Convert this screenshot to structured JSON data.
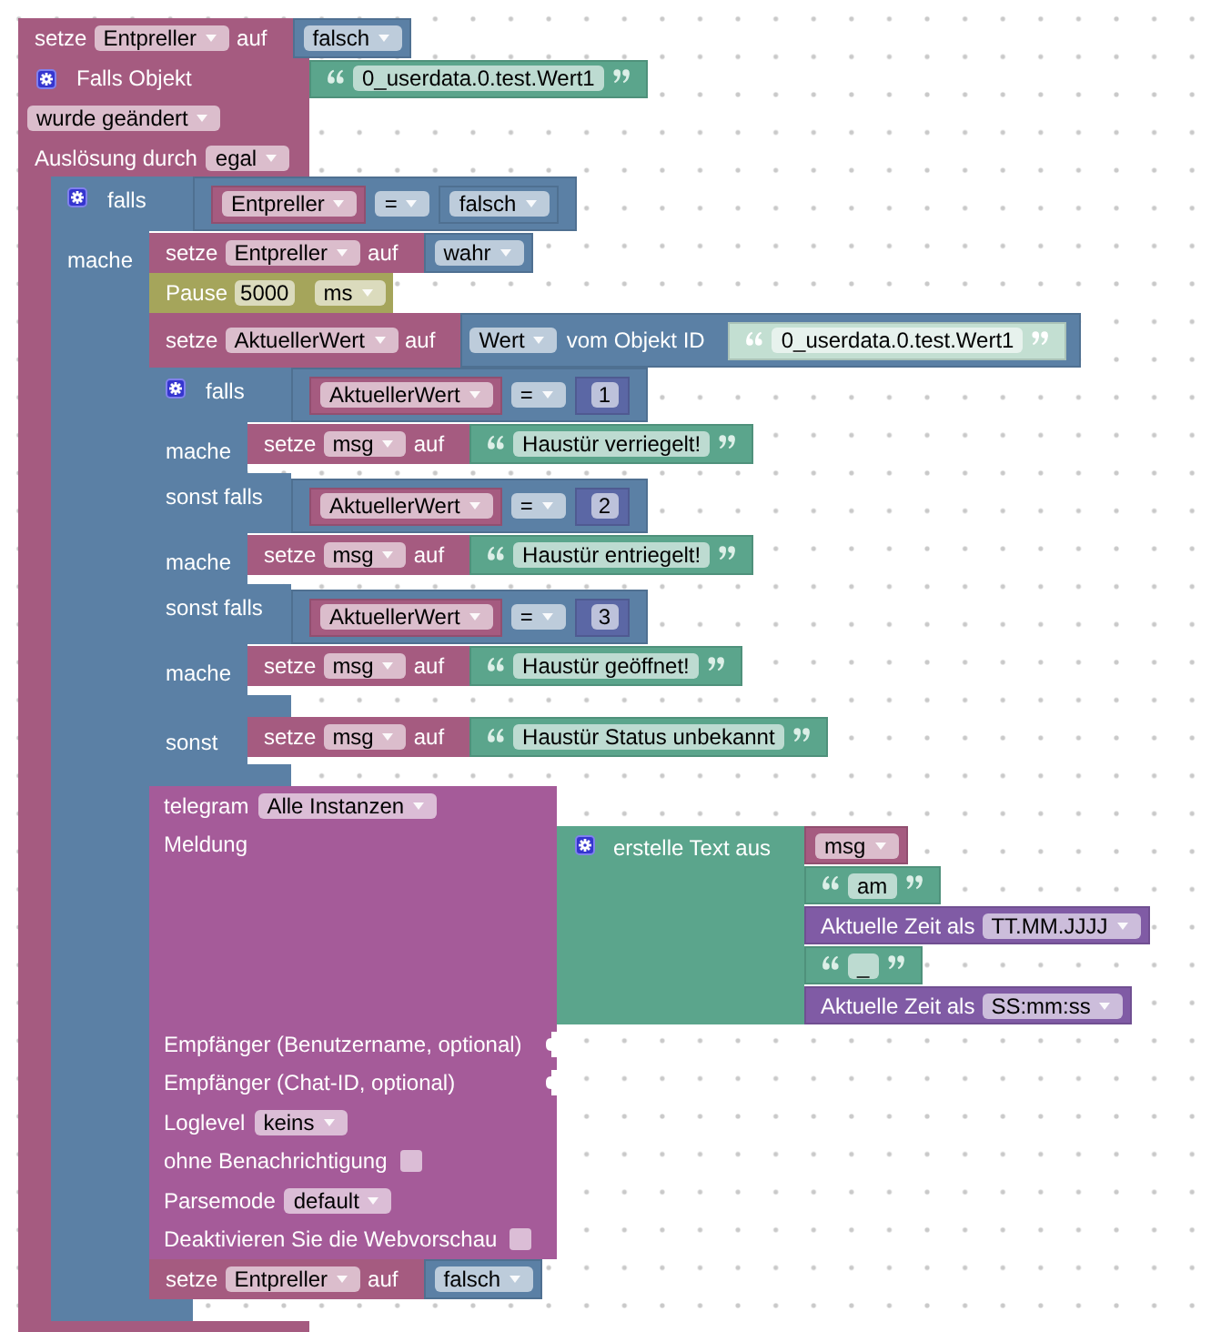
{
  "workspace": {
    "blocks": [
      {
        "kind": "set",
        "label": "setze",
        "variable": "Entpreller",
        "connector": "auf",
        "value": {
          "kind": "boolean",
          "value": "falsch"
        }
      },
      {
        "kind": "trigger",
        "title": "Falls Objekt",
        "object_id": {
          "kind": "text",
          "text": "0_userdata.0.test.Wert1"
        },
        "event": "wurde geändert",
        "source_label": "Auslösung durch",
        "source": "egal",
        "statements": [
          {
            "kind": "if",
            "branches": [
              {
                "kind": "condition",
                "label": "falls",
                "value": {
                  "kind": "compare",
                  "left": {
                    "kind": "variable",
                    "name": "Entpreller"
                  },
                  "operator": "=",
                  "right": {
                    "kind": "boolean",
                    "value": "falsch"
                  }
                }
              },
              {
                "kind": "do",
                "label": "mache",
                "statements": [
                  {
                    "kind": "set",
                    "label": "setze",
                    "variable": "Entpreller",
                    "connector": "auf",
                    "value": {
                      "kind": "boolean",
                      "value": "wahr"
                    }
                  },
                  {
                    "kind": "pause",
                    "label": "Pause",
                    "amount": "5000",
                    "unit": "ms"
                  },
                  {
                    "kind": "set",
                    "label": "setze",
                    "variable": "AktuellerWert",
                    "connector": "auf",
                    "value": {
                      "kind": "get_state",
                      "attribute": "Wert",
                      "label": "vom Objekt ID",
                      "object_id": {
                        "kind": "text",
                        "text": "0_userdata.0.test.Wert1",
                        "shadow": true
                      }
                    }
                  },
                  {
                    "kind": "if",
                    "branches": [
                      {
                        "kind": "condition",
                        "label": "falls",
                        "value": {
                          "kind": "compare",
                          "left": {
                            "kind": "variable",
                            "name": "AktuellerWert"
                          },
                          "operator": "=",
                          "right": {
                            "kind": "number",
                            "value": "1"
                          }
                        }
                      },
                      {
                        "kind": "do",
                        "label": "mache",
                        "statements": [
                          {
                            "kind": "set",
                            "label": "setze",
                            "variable": "msg",
                            "connector": "auf",
                            "value": {
                              "kind": "text",
                              "text": "Haustür verriegelt!"
                            }
                          }
                        ]
                      },
                      {
                        "kind": "condition",
                        "label": "sonst falls",
                        "value": {
                          "kind": "compare",
                          "left": {
                            "kind": "variable",
                            "name": "AktuellerWert"
                          },
                          "operator": "=",
                          "right": {
                            "kind": "number",
                            "value": "2"
                          }
                        }
                      },
                      {
                        "kind": "do",
                        "label": "mache",
                        "statements": [
                          {
                            "kind": "set",
                            "label": "setze",
                            "variable": "msg",
                            "connector": "auf",
                            "value": {
                              "kind": "text",
                              "text": "Haustür entriegelt!"
                            }
                          }
                        ]
                      },
                      {
                        "kind": "condition",
                        "label": "sonst falls",
                        "value": {
                          "kind": "compare",
                          "left": {
                            "kind": "variable",
                            "name": "AktuellerWert"
                          },
                          "operator": "=",
                          "right": {
                            "kind": "number",
                            "value": "3"
                          }
                        }
                      },
                      {
                        "kind": "do",
                        "label": "mache",
                        "statements": [
                          {
                            "kind": "set",
                            "label": "setze",
                            "variable": "msg",
                            "connector": "auf",
                            "value": {
                              "kind": "text",
                              "text": "Haustür geöffnet!"
                            }
                          }
                        ]
                      },
                      {
                        "kind": "else",
                        "label": "sonst",
                        "statements": [
                          {
                            "kind": "set",
                            "label": "setze",
                            "variable": "msg",
                            "connector": "auf",
                            "value": {
                              "kind": "text",
                              "text": "Haustür Status unbekannt"
                            }
                          }
                        ]
                      }
                    ]
                  },
                  {
                    "kind": "telegram",
                    "label": "telegram",
                    "instance": "Alle Instanzen",
                    "inputs": [
                      {
                        "kind": "value",
                        "label": "Meldung",
                        "value": {
                          "kind": "join",
                          "label": "erstelle Text aus",
                          "items": [
                            {
                              "kind": "variable",
                              "name": "msg"
                            },
                            {
                              "kind": "text",
                              "text": "am"
                            },
                            {
                              "kind": "time",
                              "label": "Aktuelle Zeit als",
                              "format": "TT.MM.JJJJ"
                            },
                            {
                              "kind": "text",
                              "text": "_"
                            },
                            {
                              "kind": "time",
                              "label": "Aktuelle Zeit als",
                              "format": "SS:mm:ss"
                            }
                          ]
                        }
                      },
                      {
                        "kind": "value",
                        "label": "Empfänger (Benutzername, optional)"
                      },
                      {
                        "kind": "value",
                        "label": "Empfänger (Chat-ID, optional)"
                      },
                      {
                        "kind": "dropdown",
                        "label": "Loglevel",
                        "value": "keins"
                      },
                      {
                        "kind": "checkbox",
                        "label": "ohne Benachrichtigung",
                        "checked": false
                      },
                      {
                        "kind": "dropdown",
                        "label": "Parsemode",
                        "value": "default"
                      },
                      {
                        "kind": "checkbox",
                        "label": "Deaktivieren Sie die Webvorschau",
                        "checked": false
                      }
                    ]
                  },
                  {
                    "kind": "set",
                    "label": "setze",
                    "variable": "Entpreller",
                    "connector": "auf",
                    "value": {
                      "kind": "boolean",
                      "value": "falsch"
                    }
                  }
                ]
              }
            ]
          }
        ]
      }
    ]
  }
}
